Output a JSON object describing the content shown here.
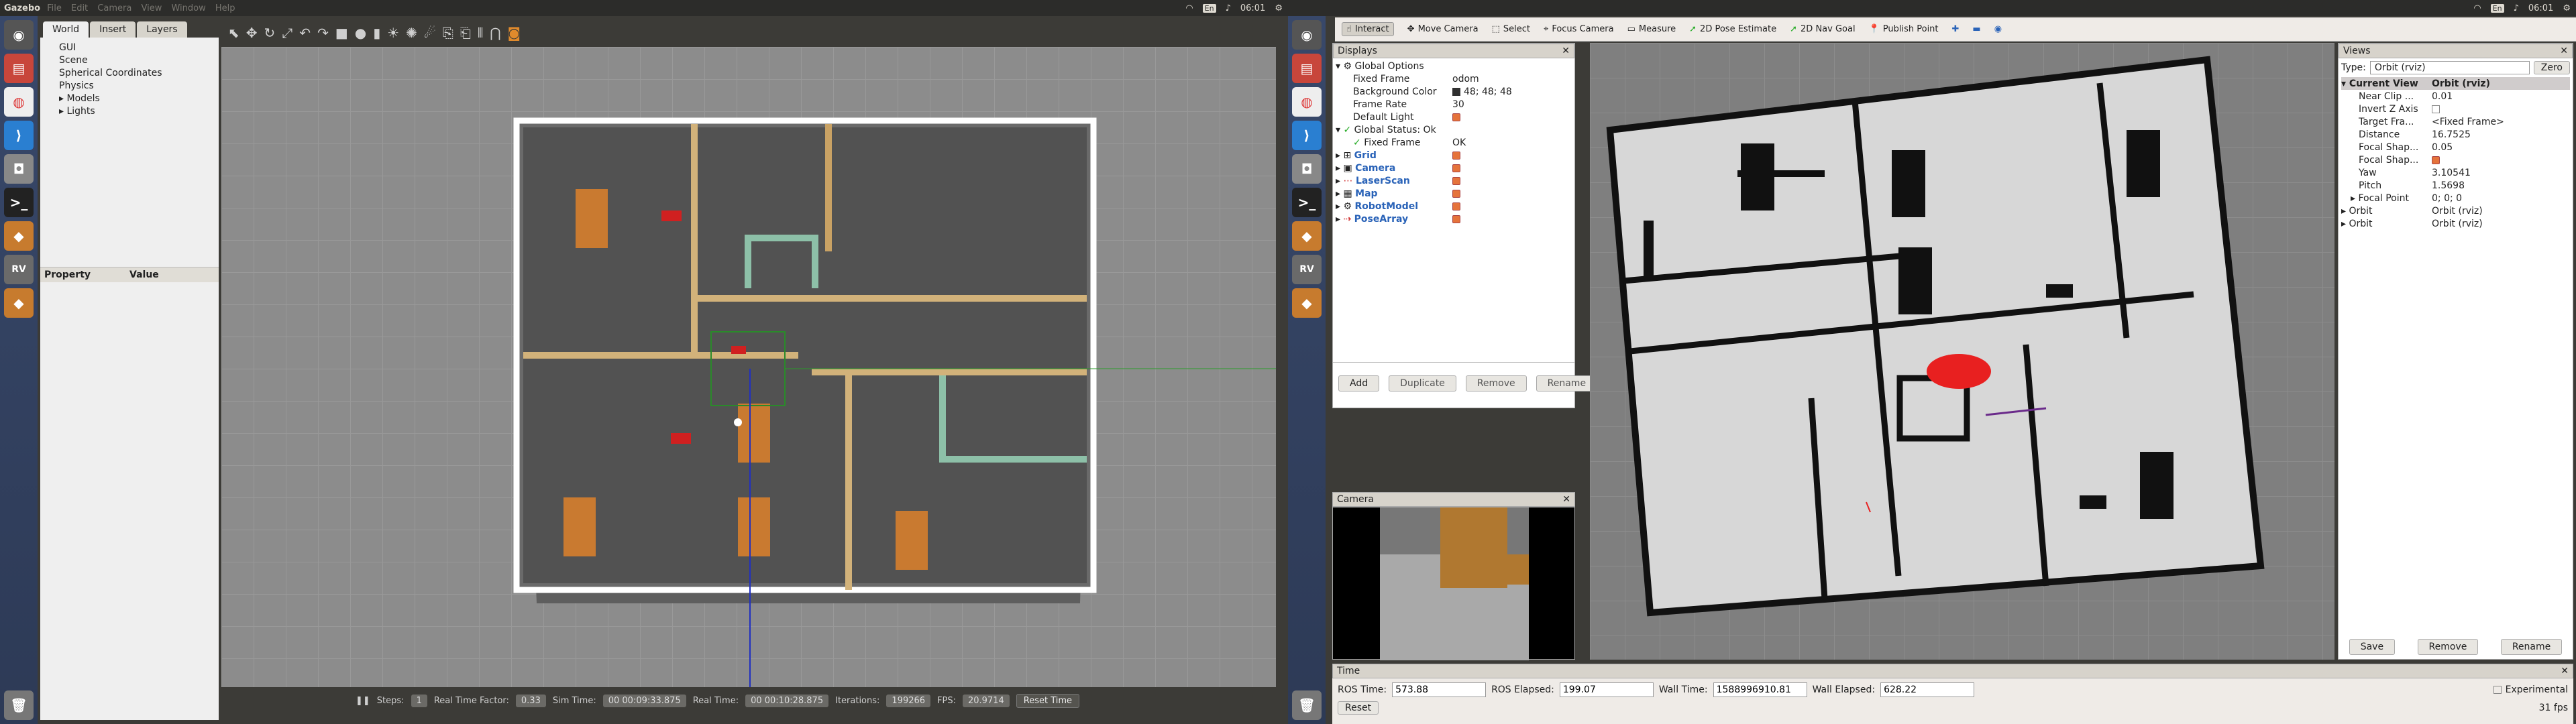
{
  "left_screen": {
    "app_title": "Gazebo",
    "menus": [
      "File",
      "Edit",
      "Camera",
      "View",
      "Window",
      "Help"
    ],
    "clock": "06:01",
    "tabs": [
      "World",
      "Insert",
      "Layers"
    ],
    "tree": [
      "GUI",
      "Scene",
      "Spherical Coordinates",
      "Physics",
      "Models",
      "Lights"
    ],
    "prop_headers": [
      "Property",
      "Value"
    ],
    "bottom": {
      "steps_label": "Steps:",
      "steps_val": "1",
      "rtf_label": "Real Time Factor:",
      "rtf_val": "0.33",
      "sim_label": "Sim Time:",
      "sim_val": "00 00:09:33.875",
      "real_label": "Real Time:",
      "real_val": "00 00:10:28.875",
      "iter_label": "Iterations:",
      "iter_val": "199266",
      "fps_label": "FPS:",
      "fps_val": "20.9714",
      "reset": "Reset Time"
    }
  },
  "right_screen": {
    "clock": "06:01",
    "tools": [
      "Interact",
      "Move Camera",
      "Select",
      "Focus Camera",
      "Measure",
      "2D Pose Estimate",
      "2D Nav Goal",
      "Publish Point"
    ],
    "displays_title": "Displays",
    "displays": [
      {
        "name": "Global Options",
        "value": ""
      },
      {
        "name": "Fixed Frame",
        "value": "odom"
      },
      {
        "name": "Background Color",
        "value": "48; 48; 48"
      },
      {
        "name": "Frame Rate",
        "value": "30"
      },
      {
        "name": "Default Light",
        "value": ""
      },
      {
        "name": "Global Status: Ok",
        "value": ""
      },
      {
        "name": "Fixed Frame",
        "value": "OK"
      },
      {
        "name": "Grid",
        "value": ""
      },
      {
        "name": "Camera",
        "value": ""
      },
      {
        "name": "LaserScan",
        "value": ""
      },
      {
        "name": "Map",
        "value": ""
      },
      {
        "name": "RobotModel",
        "value": ""
      },
      {
        "name": "PoseArray",
        "value": ""
      }
    ],
    "display_buttons": [
      "Add",
      "Duplicate",
      "Remove",
      "Rename"
    ],
    "camera_title": "Camera",
    "views_title": "Views",
    "views_type_label": "Type:",
    "views_type": "Orbit (rviz)",
    "views_zero": "Zero",
    "views": [
      {
        "name": "Current View",
        "value": "Orbit (rviz)"
      },
      {
        "name": "Near Clip ...",
        "value": "0.01"
      },
      {
        "name": "Invert Z Axis",
        "value": ""
      },
      {
        "name": "Target Fra...",
        "value": "<Fixed Frame>"
      },
      {
        "name": "Distance",
        "value": "16.7525"
      },
      {
        "name": "Focal Shap...",
        "value": "0.05"
      },
      {
        "name": "Focal Shap...",
        "value": ""
      },
      {
        "name": "Yaw",
        "value": "3.10541"
      },
      {
        "name": "Pitch",
        "value": "1.5698"
      },
      {
        "name": "Focal Point",
        "value": "0; 0; 0"
      },
      {
        "name": "Orbit",
        "value": "Orbit (rviz)"
      },
      {
        "name": "Orbit",
        "value": "Orbit (rviz)"
      }
    ],
    "views_buttons": [
      "Save",
      "Remove",
      "Rename"
    ],
    "time_title": "Time",
    "ros_time_label": "ROS Time:",
    "ros_time": "573.88",
    "ros_elapsed_label": "ROS Elapsed:",
    "ros_elapsed": "199.07",
    "wall_time_label": "Wall Time:",
    "wall_time": "1588996910.81",
    "wall_elapsed_label": "Wall Elapsed:",
    "wall_elapsed": "628.22",
    "experimental": "Experimental",
    "reset": "Reset",
    "fps": "31 fps"
  }
}
